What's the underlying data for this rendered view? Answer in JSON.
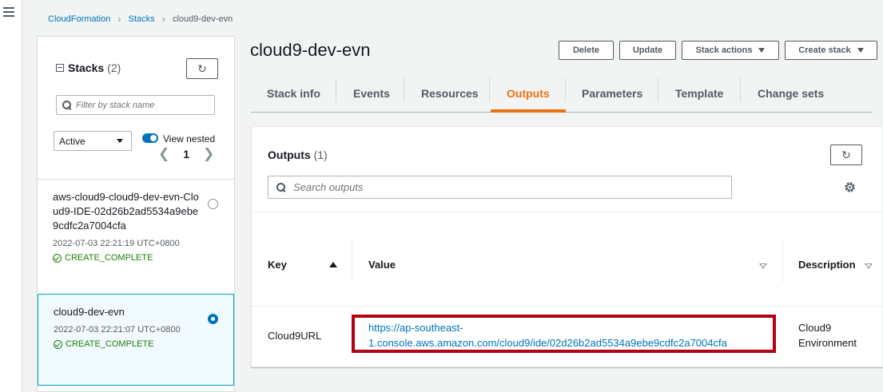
{
  "breadcrumb": [
    "CloudFormation",
    "Stacks",
    "cloud9-dev-evn"
  ],
  "stacks_panel": {
    "title": "Stacks",
    "count": "(2)",
    "filter_placeholder": "Filter by stack name",
    "status_filter": "Active",
    "view_nested_label": "View nested",
    "page": "1",
    "items": [
      {
        "name": "aws-cloud9-cloud9-dev-evn-Cloud9-IDE-02d26b2ad5534a9ebe9cdfc2a7004cfa",
        "created": "2022-07-03 22:21:19 UTC+0800",
        "status": "CREATE_COMPLETE",
        "selected": false
      },
      {
        "name": "cloud9-dev-evn",
        "created": "2022-07-03 22:21:07 UTC+0800",
        "status": "CREATE_COMPLETE",
        "selected": true
      }
    ]
  },
  "stack": {
    "title": "cloud9-dev-evn",
    "actions": {
      "delete": "Delete",
      "update": "Update",
      "stack_actions": "Stack actions",
      "create_stack": "Create stack"
    }
  },
  "tabs": [
    "Stack info",
    "Events",
    "Resources",
    "Outputs",
    "Parameters",
    "Template",
    "Change sets"
  ],
  "active_tab": "Outputs",
  "outputs": {
    "title": "Outputs",
    "count": "(1)",
    "search_placeholder": "Search outputs",
    "columns": {
      "key": "Key",
      "value": "Value",
      "description": "Description"
    },
    "rows": [
      {
        "key": "Cloud9URL",
        "value": "https://ap-southeast-1.console.aws.amazon.com/cloud9/ide/02d26b2ad5534a9ebe9cdfc2a7004cfa",
        "value_line1": "https://ap-southeast-",
        "value_line2": "1.console.aws.amazon.com/cloud9/ide/02d26b2ad5534a9ebe9cdfc2a7004cfa",
        "description_line1": "Cloud9",
        "description_line2": "Environment"
      }
    ]
  },
  "colors": {
    "link": "#0073bb",
    "active_tab": "#ec7211",
    "status_complete": "#1d8102",
    "highlight": "#b30012"
  }
}
